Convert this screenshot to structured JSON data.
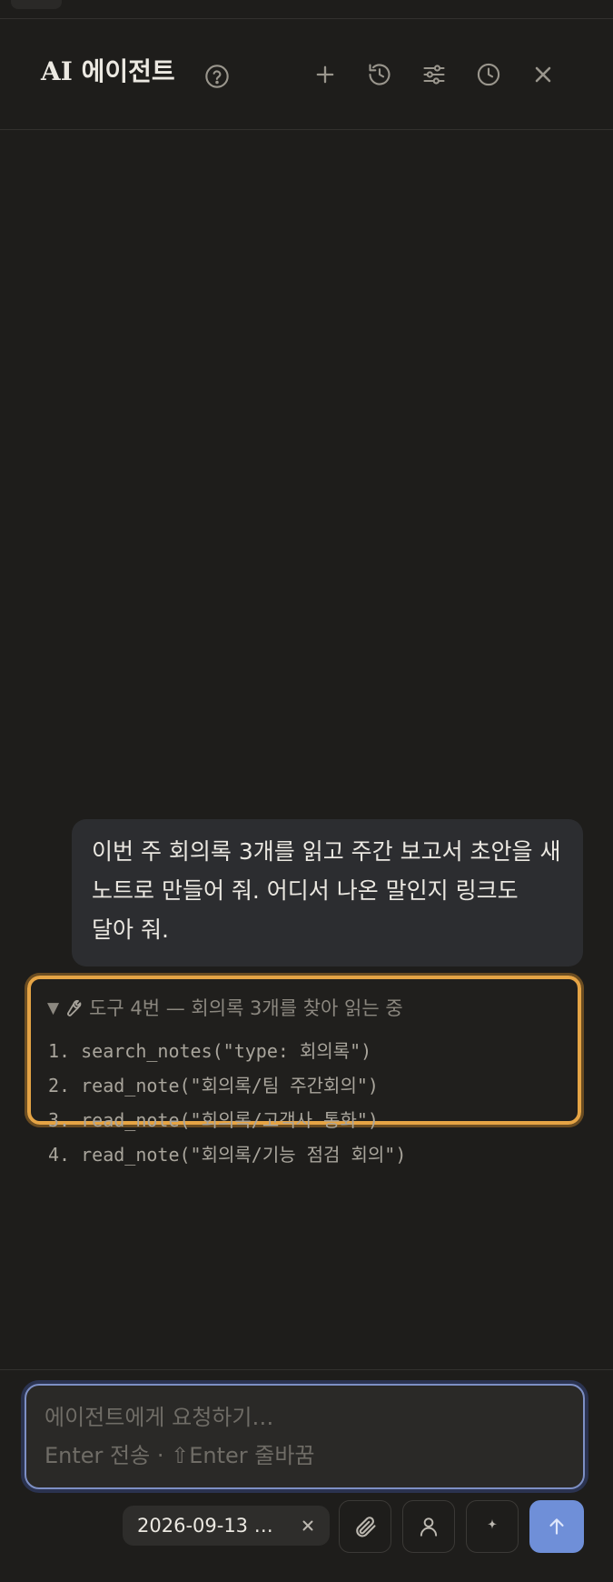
{
  "header": {
    "title": "AI 에이전트",
    "icons": [
      "help-icon",
      "plus-icon",
      "history-icon",
      "sliders-icon",
      "clock-icon",
      "close-icon"
    ]
  },
  "conversation": {
    "user_message": "이번 주 회의록 3개를 읽고 주간 보고서 초안을 새 노트로 만들어 줘. 어디서 나온 말인지 링크도 달아 줘.",
    "tool_card": {
      "header": "도구 4번 — 회의록 3개를 찾아 읽는 중",
      "calls": [
        "1. search_notes(\"type: 회의록\")",
        "2. read_note(\"회의록/팀 주간회의\")",
        "3. read_note(\"회의록/고객사 통화\")",
        "4. read_note(\"회의록/기능 점검 회의\")"
      ]
    }
  },
  "composer": {
    "placeholder_line1": "에이전트에게 요청하기…",
    "placeholder_line2": "Enter 전송 · ⇧Enter 줄바꿈",
    "context_chip": "2026-09-13 …",
    "buttons": [
      "paperclip-icon",
      "person-icon",
      "sparkle-icon",
      "arrow-up-icon"
    ]
  },
  "colors": {
    "background": "#1e1d1b",
    "tool_card_border": "#e5a445",
    "input_focus_border": "#7d8fc4",
    "send_button": "#6f8fd8",
    "user_bubble": "#2c2d30"
  }
}
